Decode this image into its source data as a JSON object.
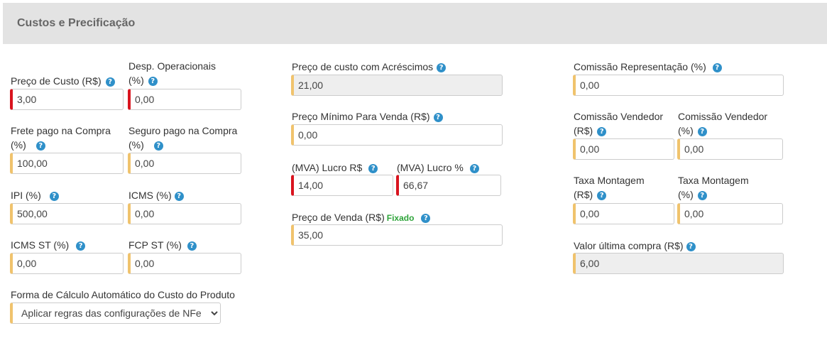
{
  "panel": {
    "title": "Custos e Precificação"
  },
  "help_glyph": "?",
  "fields": {
    "preco_custo": {
      "label": "Preço de Custo (R$)",
      "value": "3,00"
    },
    "desp_operacionais": {
      "label_line1": "Desp. Operacionais",
      "label_line2": "(%)",
      "value": "0,00"
    },
    "frete": {
      "label_line1": "Frete pago na Compra",
      "label_line2": "(%)",
      "value": "100,00"
    },
    "seguro": {
      "label_line1": "Seguro pago na Compra",
      "label_line2": "(%)",
      "value": "0,00"
    },
    "ipi": {
      "label": "IPI (%)",
      "value": "500,00"
    },
    "icms": {
      "label": "ICMS (%)",
      "value": "0,00"
    },
    "icms_st": {
      "label": "ICMS ST (%)",
      "value": "0,00"
    },
    "fcp_st": {
      "label": "FCP ST (%)",
      "value": "0,00"
    },
    "forma_calculo": {
      "label": "Forma de Cálculo Automático do Custo do Produto",
      "selected": "Aplicar regras das configurações de NFe"
    },
    "custo_acrescimos": {
      "label": "Preço de custo com Acréscimos",
      "value": "21,00"
    },
    "preco_minimo": {
      "label": "Preço Mínimo Para Venda (R$)",
      "value": "0,00"
    },
    "mva_lucro_rs": {
      "label": "(MVA) Lucro R$",
      "value": "14,00"
    },
    "mva_lucro_pct": {
      "label": "(MVA) Lucro %",
      "value": "66,67"
    },
    "preco_venda": {
      "label": "Preço de Venda (R$)",
      "badge": "Fixado",
      "value": "35,00"
    },
    "comissao_representacao": {
      "label": "Comissão Representação (%)",
      "value": "0,00"
    },
    "comissao_vendedor_rs": {
      "label_line1": "Comissão Vendedor",
      "label_line2": "(R$)",
      "value": "0,00"
    },
    "comissao_vendedor_pct": {
      "label_line1": "Comissão Vendedor",
      "label_line2": "(%)",
      "value": "0,00"
    },
    "taxa_montagem_rs": {
      "label_line1": "Taxa Montagem",
      "label_line2": "(R$)",
      "value": "0,00"
    },
    "taxa_montagem_pct": {
      "label_line1": "Taxa Montagem",
      "label_line2": "(%)",
      "value": "0,00"
    },
    "valor_ultima_compra": {
      "label": "Valor última compra (R$)",
      "value": "6,00"
    }
  },
  "colors": {
    "required_border": "#d9141e",
    "warning_border": "#f0c36d",
    "help_icon": "#2f90c9",
    "fixado_badge": "#2ea43a",
    "header_bg": "#e3e3e3"
  }
}
